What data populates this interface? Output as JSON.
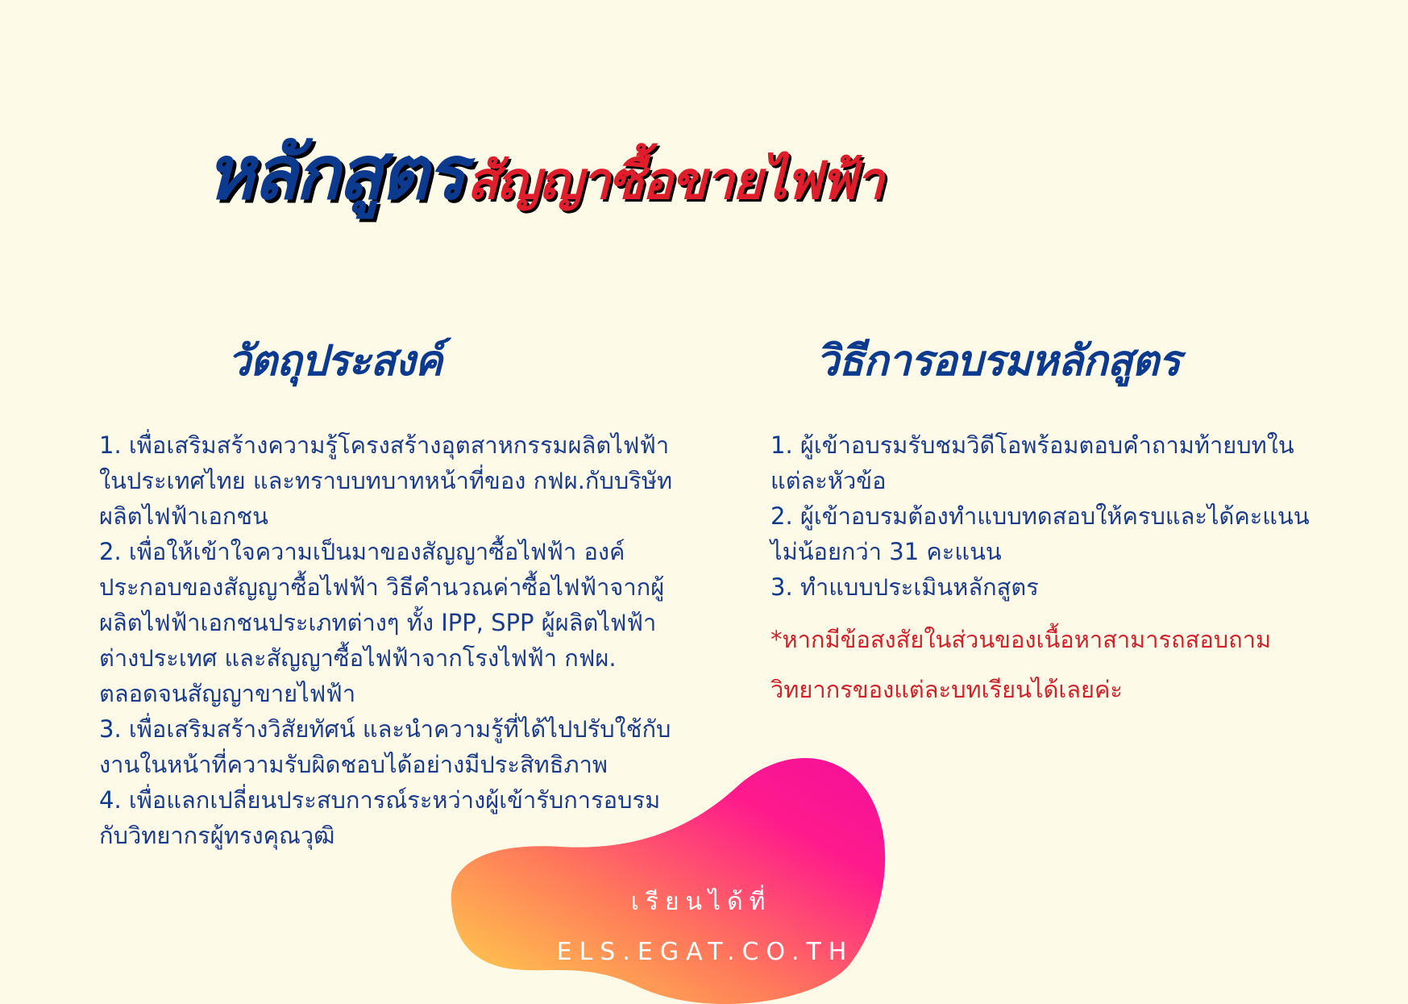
{
  "title": {
    "main": "หลักสูตร",
    "sub": "สัญญาซื้อขายไฟฟ้า"
  },
  "objectives": {
    "heading": "วัตถุประสงค์",
    "items": [
      {
        "num": "1.",
        "text": "เพื่อเสริมสร้างความรู้โครงสร้างอุตสาหกรรมผลิตไฟฟ้าในประเทศไทย และทราบบทบาทหน้าที่ของ กฟผ.กับบริษัทผลิตไฟฟ้าเอกชน"
      },
      {
        "num": "2.",
        "text": "เพื่อให้เข้าใจความเป็นมาของสัญญาซื้อไฟฟ้า องค์ประกอบของสัญญาซื้อไฟฟ้า วิธีคำนวณค่าซื้อไฟฟ้าจากผู้ผลิตไฟฟ้าเอกชนประเภทต่างๆ ทั้ง IPP, SPP ผู้ผลิตไฟฟ้าต่างประเทศ และสัญญาซื้อไฟฟ้าจากโรงไฟฟ้า กฟผ. ตลอดจนสัญญาขายไฟฟ้า"
      },
      {
        "num": "3.",
        "text": "เพื่อเสริมสร้างวิสัยทัศน์ และนำความรู้ที่ได้ไปปรับใช้กับงานในหน้าที่ความรับผิดชอบได้อย่างมีประสิทธิภาพ"
      },
      {
        "num": "4.",
        "text": "เพื่อแลกเปลี่ยนประสบการณ์ระหว่างผู้เข้ารับการอบรมกับวิทยากรผู้ทรงคุณวุฒิ"
      }
    ]
  },
  "method": {
    "heading": "วิธีการอบรมหลักสูตร",
    "items": [
      {
        "num": "1.",
        "text": "ผู้เข้าอบรมรับชมวิดีโอพร้อมตอบคำถามท้ายบทในแต่ละหัวข้อ"
      },
      {
        "num": "2.",
        "text": "ผู้เข้าอบรมต้องทำแบบทดสอบให้ครบและได้คะแนนไม่น้อยกว่า 31 คะแนน"
      },
      {
        "num": "3.",
        "text": "ทำแบบประเมินหลักสูตร"
      }
    ],
    "note": "*หากมีข้อสงสัยในส่วนของเนื้อหาสามารถสอบถามวิทยากรของแต่ละบทเรียนได้เลยค่ะ"
  },
  "blob": {
    "line1": "เรียนได้ที่",
    "line2": "ELS.EGAT.CO.TH",
    "gradient": [
      "#ffd84a",
      "#ff7a5a",
      "#ff1a8c",
      "#f2109a"
    ]
  },
  "colors": {
    "background": "#fdfbe7",
    "primary": "#0c3a8f",
    "accent_red": "#e01e2b",
    "note_red": "#d0222b"
  }
}
